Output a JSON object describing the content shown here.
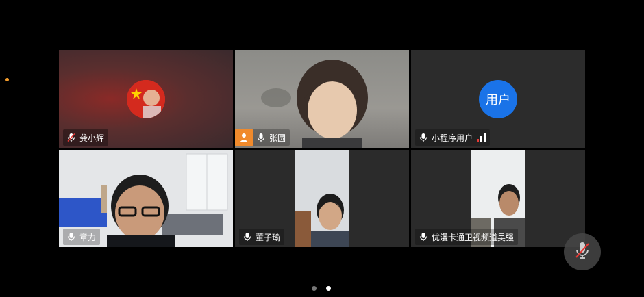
{
  "participants": [
    {
      "name": "龚小辉",
      "mic": "muted"
    },
    {
      "name": "张圆",
      "mic": "on"
    },
    {
      "name": "小程序用户",
      "mic": "on",
      "avatar_text": "用户"
    },
    {
      "name": "章力",
      "mic": "on"
    },
    {
      "name": "董子瑜",
      "mic": "on"
    },
    {
      "name": "优漫卡通卫视频道吴强",
      "mic": "on"
    }
  ],
  "pager": {
    "pages": 2,
    "current": 2
  },
  "controls": {
    "self_mic": "muted"
  },
  "colors": {
    "active_speaker_border": "#3fbf4a",
    "avatar_blue": "#1a73e8",
    "camera_badge": "#f08a2c",
    "muted_red": "#e53935"
  }
}
